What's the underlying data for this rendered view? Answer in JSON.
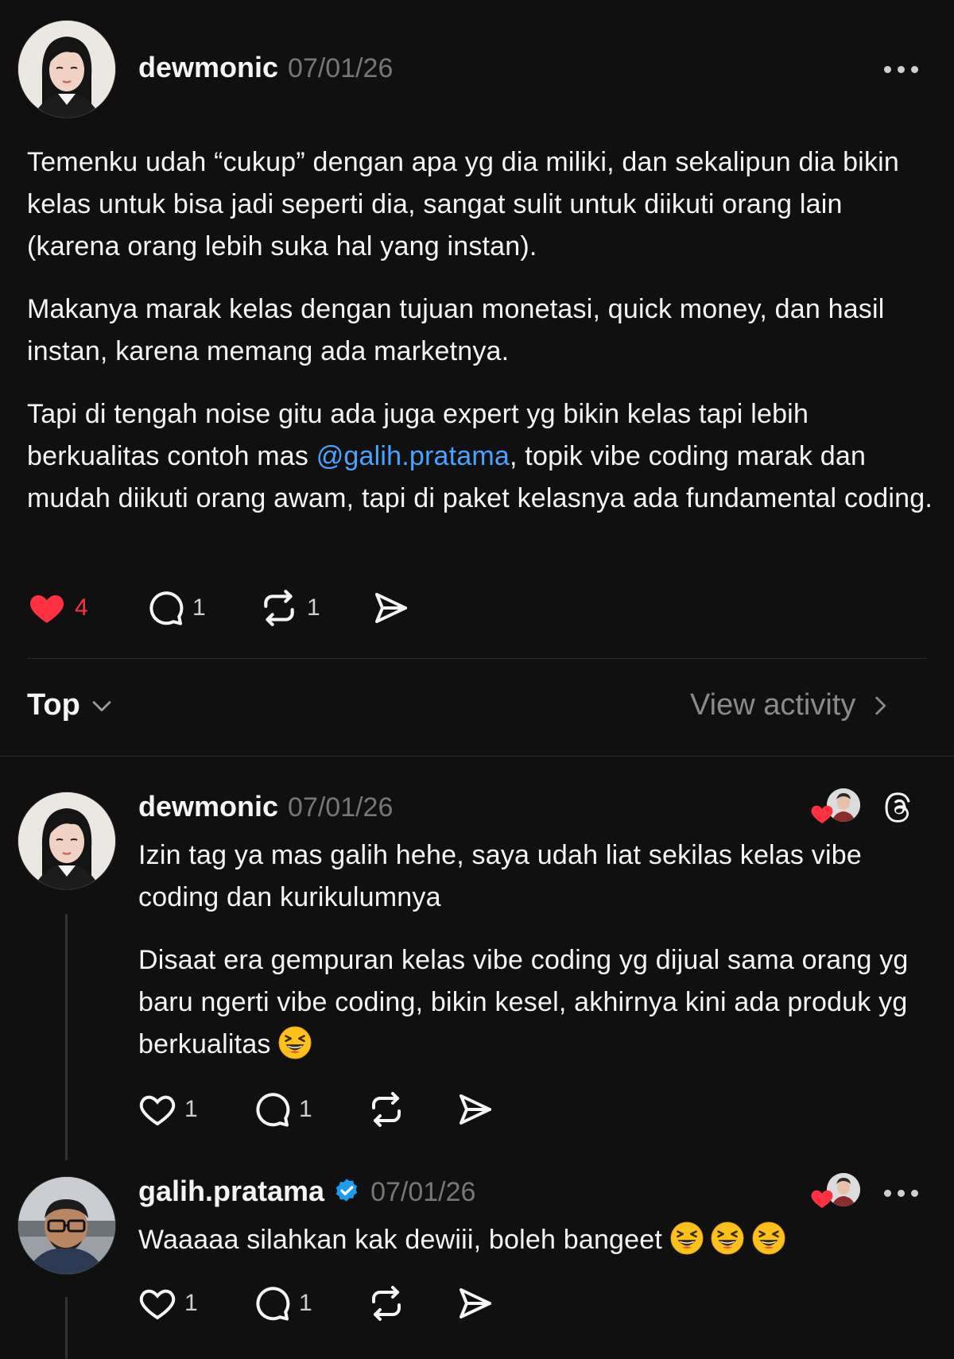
{
  "post": {
    "author": "dewmonic",
    "date": "07/01/26",
    "paragraphs": [
      "Temenku udah “cukup” dengan apa yg dia miliki, dan sekalipun dia bikin kelas untuk bisa jadi seperti dia, sangat sulit untuk diikuti orang lain (karena orang lebih suka hal yang instan).",
      "Makanya marak kelas dengan tujuan monetasi, quick money, dan hasil instan, karena memang ada marketnya."
    ],
    "p3_before": "Tapi di tengah noise gitu ada juga expert yg bikin kelas tapi lebih berkualitas contoh mas ",
    "p3_mention": "@galih.pratama",
    "p3_after": ", topik vibe coding marak dan mudah diikuti orang awam, tapi di paket kelasnya ada fundamental coding.",
    "likes": "4",
    "replies": "1",
    "reposts": "1"
  },
  "sort": {
    "label": "Top",
    "view_activity": "View activity"
  },
  "reply1": {
    "author": "dewmonic",
    "date": "07/01/26",
    "p1": "Izin tag ya mas galih hehe, saya udah liat sekilas kelas vibe coding dan kurikulumnya",
    "p2": "Disaat era gempuran kelas vibe coding yg dijual sama orang yg baru ngerti vibe coding, bikin kesel, akhirnya kini ada produk yg berkualitas",
    "likes": "1",
    "replies": "1"
  },
  "reply2": {
    "author": "galih.pratama",
    "date": "07/01/26",
    "text": "Waaaaa silahkan kak dewiii, boleh bangeet",
    "likes": "1",
    "replies": "1"
  },
  "colors": {
    "background": "#101010",
    "like_red": "#ff3040",
    "mention_blue": "#4aa3ff",
    "verified_blue": "#1d9bf0"
  },
  "icons": [
    "more-icon",
    "heart-icon",
    "comment-icon",
    "repost-icon",
    "share-icon",
    "chevron-down-icon",
    "chevron-right-icon",
    "threads-logo-icon",
    "verified-badge-icon",
    "grinning-squint-emoji"
  ]
}
